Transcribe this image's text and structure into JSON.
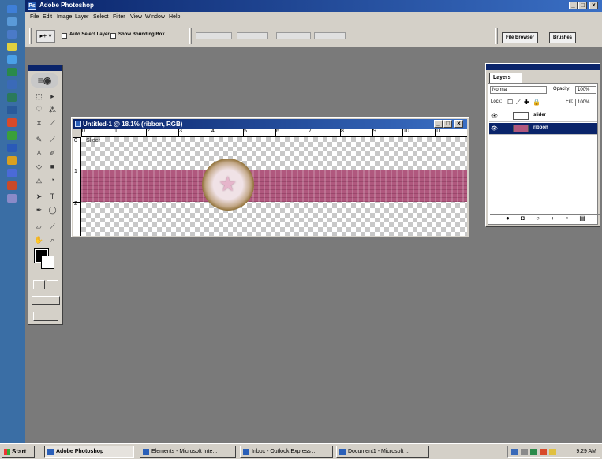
{
  "app": {
    "title": "Adobe Photoshop",
    "window_controls": [
      "_",
      "□",
      "×"
    ]
  },
  "menu": [
    "File",
    "Edit",
    "Image",
    "Layer",
    "Select",
    "Filter",
    "View",
    "Window",
    "Help"
  ],
  "options_bar": {
    "tool_preset": "▸+ ▾",
    "auto_select_layer": "Auto Select Layer",
    "show_bounding_box": "Show Bounding Box",
    "file_browser": "File Browser",
    "brushes": "Brushes"
  },
  "document": {
    "title": "Untitled-1 @ 18.1% (ribbon, RGB)",
    "ruler_numbers": [
      "0",
      "1",
      "2",
      "3",
      "4",
      "5",
      "6",
      "7",
      "8",
      "9",
      "10",
      "11"
    ],
    "vruler_numbers": [
      "0",
      "1",
      "2"
    ],
    "canvas_label": "Slider",
    "controls": [
      "_",
      "□",
      "×"
    ]
  },
  "layers_panel": {
    "tab": "Layers",
    "blend_mode": "Normal",
    "opacity_label": "Opacity:",
    "opacity_value": "100%",
    "lock_label": "Lock:",
    "fill_label": "Fill:",
    "fill_value": "100%",
    "layers": [
      {
        "name": "slider",
        "selected": false
      },
      {
        "name": "ribbon",
        "selected": true
      }
    ],
    "footer_icons": "● ◘ ○ ◐ ▫ ▤"
  },
  "taskbar": {
    "start": "Start",
    "tasks": [
      {
        "label": "Adobe Photoshop",
        "active": true
      },
      {
        "label": "Elements - Microsoft Inte...",
        "active": false
      },
      {
        "label": "Inbox - Outlook Express ...",
        "active": false
      },
      {
        "label": "Document1 - Microsoft ...",
        "active": false
      }
    ],
    "clock": "9:29 AM"
  },
  "colors": {
    "title_blue": "#0a246a",
    "workspace_gray": "#7a7a7a",
    "ribbon_pink": "#b0587e",
    "chrome": "#d4d0c8"
  }
}
